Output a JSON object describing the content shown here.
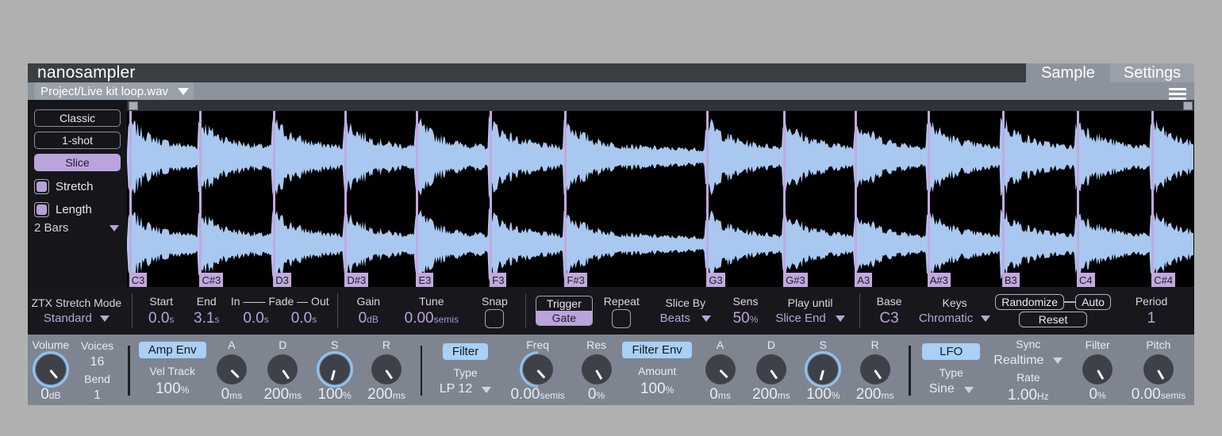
{
  "window": {
    "app_title": "nanosampler",
    "tabs": [
      {
        "label": "Sample",
        "active": true
      },
      {
        "label": "Settings",
        "active": false
      }
    ],
    "preset": "Project/Live kit loop.wav",
    "preset_caret": "chevron-down-icon",
    "menu_icon": "hamburger-menu-icon"
  },
  "left_panel": {
    "modes": [
      {
        "label": "Classic",
        "selected": false
      },
      {
        "label": "1-shot",
        "selected": false
      },
      {
        "label": "Slice",
        "selected": true
      }
    ],
    "toggles": [
      {
        "label": "Stretch",
        "on": true
      },
      {
        "label": "Length",
        "on": true
      }
    ],
    "length_value": "2 Bars",
    "stretch_mode_label": "ZTX Stretch Mode",
    "stretch_mode_value": "Standard"
  },
  "waveform": {
    "slices": [
      {
        "note": "C3",
        "pos": 0.2
      },
      {
        "note": "C#3",
        "pos": 6.8
      },
      {
        "note": "D3",
        "pos": 13.7
      },
      {
        "note": "D#3",
        "pos": 20.4
      },
      {
        "note": "E3",
        "pos": 27.1
      },
      {
        "note": "F3",
        "pos": 34.0
      },
      {
        "note": "F#3",
        "pos": 41.0
      },
      {
        "note": "G3",
        "pos": 54.3
      },
      {
        "note": "G#3",
        "pos": 61.5
      },
      {
        "note": "A3",
        "pos": 68.2
      },
      {
        "note": "A#3",
        "pos": 75.0
      },
      {
        "note": "B3",
        "pos": 82.0
      },
      {
        "note": "C4",
        "pos": 89.0
      },
      {
        "note": "C#4",
        "pos": 96.0
      }
    ]
  },
  "params": {
    "start": {
      "label": "Start",
      "value": "0.0",
      "unit": "s"
    },
    "end": {
      "label": "End",
      "value": "3.1",
      "unit": "s"
    },
    "fade_label": "In —— Fade — Out",
    "fade_in": {
      "value": "0.0",
      "unit": "s"
    },
    "fade_out": {
      "value": "0.0",
      "unit": "s"
    },
    "gain": {
      "label": "Gain",
      "value": "0",
      "unit": "dB"
    },
    "tune": {
      "label": "Tune",
      "value": "0.00",
      "unit": "semis"
    },
    "snap": {
      "label": "Snap",
      "on": false
    },
    "trigger": {
      "label": "Trigger",
      "value": "Gate"
    },
    "repeat": {
      "label": "Repeat",
      "on": false
    },
    "slice_by": {
      "label": "Slice By",
      "value": "Beats"
    },
    "sens": {
      "label": "Sens",
      "value": "50",
      "unit": "%"
    },
    "play_until": {
      "label": "Play until",
      "value": "Slice End"
    },
    "base": {
      "label": "Base",
      "value": "C3"
    },
    "keys": {
      "label": "Keys",
      "value": "Chromatic"
    },
    "randomize_label": "Randomize",
    "auto_label": "Auto",
    "reset_label": "Reset",
    "period": {
      "label": "Period",
      "value": "1"
    }
  },
  "bottom": {
    "volume": {
      "label": "Volume",
      "value": "0",
      "unit": "dB"
    },
    "voices": {
      "label": "Voices",
      "value": "16"
    },
    "bend": {
      "label": "Bend",
      "value": "1"
    },
    "amp_env": {
      "button": "Amp Env",
      "vel_track_label": "Vel Track",
      "vel_track_value": "100",
      "vel_track_unit": "%",
      "a": {
        "label": "A",
        "value": "0",
        "unit": "ms"
      },
      "d": {
        "label": "D",
        "value": "200",
        "unit": "ms"
      },
      "s": {
        "label": "S",
        "value": "100",
        "unit": "%"
      },
      "r": {
        "label": "R",
        "value": "200",
        "unit": "ms"
      }
    },
    "filter": {
      "button": "Filter",
      "type_label": "Type",
      "type_value": "LP 12",
      "freq": {
        "label": "Freq",
        "value": "0.00",
        "unit": "semis"
      },
      "res": {
        "label": "Res",
        "value": "0",
        "unit": "%"
      }
    },
    "filter_env": {
      "button": "Filter Env",
      "amount_label": "Amount",
      "amount_value": "100",
      "amount_unit": "%",
      "a": {
        "label": "A",
        "value": "0",
        "unit": "ms"
      },
      "d": {
        "label": "D",
        "value": "200",
        "unit": "ms"
      },
      "s": {
        "label": "S",
        "value": "100",
        "unit": "%"
      },
      "r": {
        "label": "R",
        "value": "200",
        "unit": "ms"
      }
    },
    "lfo": {
      "button": "LFO",
      "type_label": "Type",
      "type_value": "Sine",
      "sync_label": "Sync",
      "sync_value": "Realtime",
      "rate_label": "Rate",
      "rate_value": "1.00",
      "rate_unit": "Hz",
      "filter": {
        "label": "Filter",
        "value": "0",
        "unit": "%"
      },
      "pitch": {
        "label": "Pitch",
        "value": "0.00",
        "unit": "semis"
      }
    }
  },
  "colors": {
    "accent_purple": "#bba3dd",
    "accent_blue": "#a9d0f7",
    "panel_grey": "#7e8590",
    "dark_bg": "#17171c"
  }
}
